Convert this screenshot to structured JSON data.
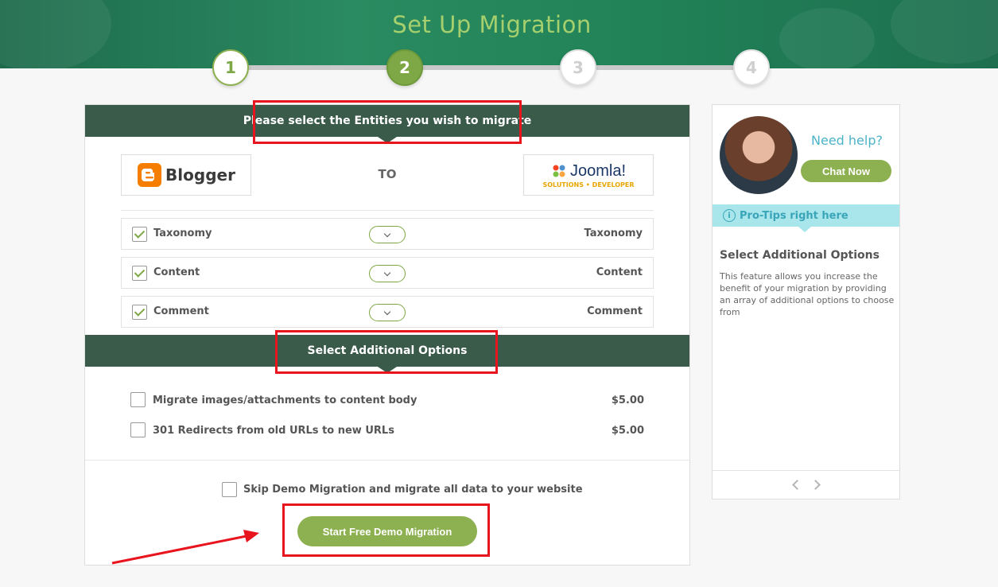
{
  "header": {
    "title": "Set Up Migration",
    "steps": [
      {
        "num": "1",
        "state": "done"
      },
      {
        "num": "2",
        "state": "active"
      },
      {
        "num": "3",
        "state": "todo"
      },
      {
        "num": "4",
        "state": "todo"
      }
    ]
  },
  "main": {
    "entities_title": "Please select the Entities you wish to migrate",
    "source_platform": "Blogger",
    "to_label": "TO",
    "target_platform": "Joomla!",
    "target_tagline": "SOLUTIONS • DEVELOPER",
    "entities": [
      {
        "source": "Taxonomy",
        "target": "Taxonomy",
        "checked": true
      },
      {
        "source": "Content",
        "target": "Content",
        "checked": true
      },
      {
        "source": "Comment",
        "target": "Comment",
        "checked": true
      }
    ],
    "options_title": "Select Additional Options",
    "options": [
      {
        "label": "Migrate images/attachments to content body",
        "price": "$5.00",
        "checked": false
      },
      {
        "label": "301 Redirects from old URLs to new URLs",
        "price": "$5.00",
        "checked": false
      }
    ],
    "skip_demo_label": "Skip Demo Migration and migrate all data to your website",
    "start_button": "Start Free Demo Migration"
  },
  "help": {
    "need_help": "Need help?",
    "chat_button": "Chat Now",
    "protips_label": "Pro-Tips right here",
    "info_glyph": "i",
    "tip_title": "Select Additional Options",
    "tip_text": "This feature allows you increase the benefit of your migration by providing an array of additional options to choose from"
  },
  "colors": {
    "accent_green": "#8db050",
    "band_dark_green": "#3a5a4a",
    "annotation_red": "#e8141e",
    "help_cyan": "#4db3c8"
  }
}
